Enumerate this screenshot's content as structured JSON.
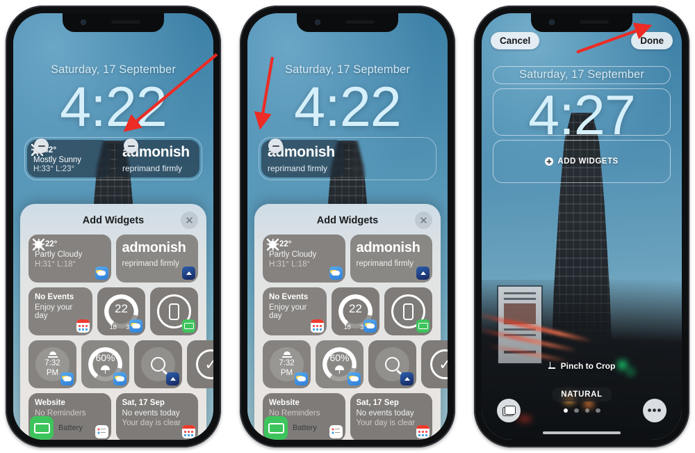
{
  "lock_screen": {
    "date": "Saturday, 17 September",
    "time_editing": "4:22",
    "time_final": "4:27",
    "weather_widget": {
      "temp": "32°",
      "condition": "Mostly Sunny",
      "range": "H:33° L:23°"
    },
    "dictionary_widget": {
      "word": "admonish",
      "definition": "reprimand firmly"
    },
    "remove_badge_label": "−"
  },
  "sheet": {
    "title": "Add Widgets",
    "close_label": "✕",
    "widgets": [
      {
        "name": "weather-conditions",
        "size": "wide",
        "line1": "22°",
        "line2": "Partly Cloudy",
        "line3": "H:31° L:18°",
        "badge": "weather-app-icon"
      },
      {
        "name": "dictionary-word",
        "size": "wide",
        "title": "admonish",
        "sub": "reprimand firmly",
        "badge": "dictionary-app-icon"
      },
      {
        "name": "calendar-no-events",
        "size": "wide",
        "line1": "No Events",
        "line2": "Enjoy your day",
        "badge": "calendar-app-icon"
      },
      {
        "name": "weather-temperature-gauge",
        "size": "square",
        "value": "22",
        "low": "18",
        "high": "31",
        "badge": "weather-app-icon"
      },
      {
        "name": "battery-level",
        "size": "square",
        "badge": "battery-app-icon"
      },
      {
        "name": "weather-sunset",
        "size": "square",
        "time": "7:32",
        "meridiem": "PM",
        "badge": "weather-app-icon"
      },
      {
        "name": "weather-rain-chance",
        "size": "square",
        "value": "60%",
        "badge": "weather-app-icon"
      },
      {
        "name": "dictionary-search",
        "size": "square",
        "badge": "dictionary-app-icon"
      },
      {
        "name": "reminders-complete",
        "size": "square",
        "badge": "reminders-app-icon"
      },
      {
        "name": "reminders-website",
        "size": "wide",
        "line1": "Website",
        "line2": "No Reminders",
        "badge": "reminders-list-icon"
      },
      {
        "name": "calendar-day",
        "size": "wide",
        "line1": "Sat, 17 Sep",
        "line2": "No events today",
        "line3": "Your day is clear",
        "badge": "calendar-app-icon"
      }
    ],
    "footer_app": "Battery"
  },
  "editor": {
    "cancel": "Cancel",
    "done": "Done",
    "add_widgets": "ADD WIDGETS",
    "pinch_to_crop": "Pinch to Crop",
    "style_name": "NATURAL",
    "page_dots": 4,
    "active_dot": 1
  },
  "colors": {
    "accent_arrow": "#ec2c25",
    "sky": "#4a8cb0",
    "sheet": "#e6e4e2",
    "card": "#85827f"
  }
}
